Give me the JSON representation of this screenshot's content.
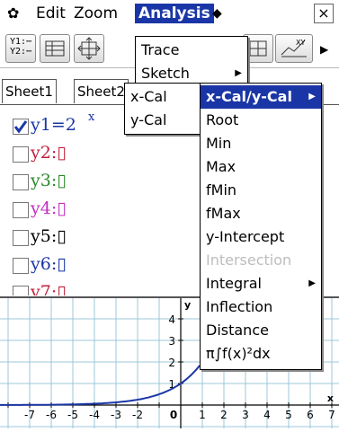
{
  "menubar": {
    "edit": "Edit",
    "zoom": "Zoom",
    "analysis": "Analysis",
    "close": "×"
  },
  "toolbar": {
    "y1y2_line1": "Y1:",
    "y1y2_line2": "Y2:"
  },
  "tabs": {
    "sheet1": "Sheet1",
    "sheet2": "Sheet2"
  },
  "functions": [
    {
      "label": "y1=2",
      "sup": "x",
      "checked": true,
      "color": "#1a36a6"
    },
    {
      "label": "y2:▯",
      "checked": false,
      "color": "#c0203a"
    },
    {
      "label": "y3:▯",
      "checked": false,
      "color": "#2a8a2a"
    },
    {
      "label": "y4:▯",
      "checked": false,
      "color": "#c030c0"
    },
    {
      "label": "y5:▯",
      "checked": false,
      "color": "#000000"
    },
    {
      "label": "y6:▯",
      "checked": false,
      "color": "#1a36a6"
    },
    {
      "label": "y7:▯",
      "checked": false,
      "color": "#c0203a"
    }
  ],
  "analysis_menu": {
    "trace": "Trace",
    "sketch": "Sketch"
  },
  "calc_menu": {
    "xcal": "x-Cal",
    "ycal": "y-Cal"
  },
  "gsolve_menu": [
    {
      "label": "x-Cal/y-Cal",
      "selected": true,
      "submenu": true
    },
    {
      "label": "Root"
    },
    {
      "label": "Min"
    },
    {
      "label": "Max"
    },
    {
      "label": "fMin"
    },
    {
      "label": "fMax"
    },
    {
      "label": "y-Intercept"
    },
    {
      "label": "Intersection",
      "disabled": true
    },
    {
      "label": "Integral",
      "submenu": true
    },
    {
      "label": "Inflection"
    },
    {
      "label": "Distance"
    },
    {
      "label": "π∫f(x)²dx"
    }
  ],
  "graph": {
    "x_labels": [
      "-7",
      "-6",
      "-5",
      "-4",
      "-3",
      "-2",
      "0",
      "1",
      "2",
      "3",
      "4",
      "5",
      "6",
      "7"
    ],
    "y_labels": [
      "4",
      "3",
      "2",
      "1"
    ],
    "x_axis_label": "x",
    "y_axis_label": "y"
  },
  "colors": {
    "accent": "#1a36a6",
    "grid": "#9cc7d9",
    "curve": "#1a36a6"
  }
}
